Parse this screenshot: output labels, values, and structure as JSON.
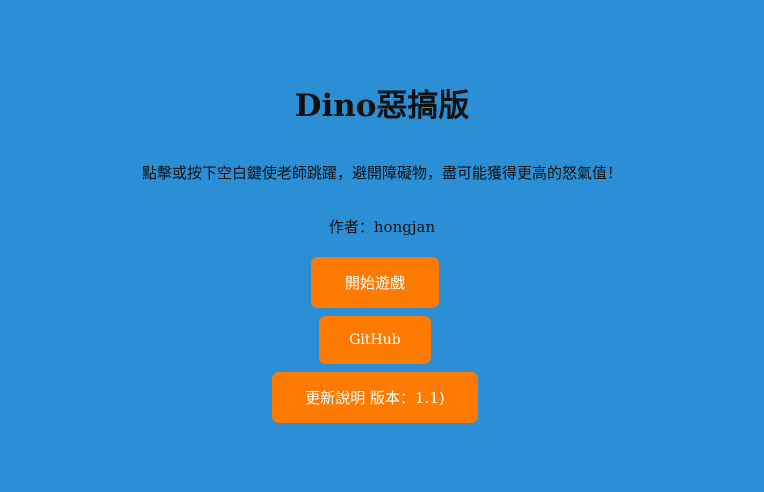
{
  "title": "Dino惡搞版",
  "description": "點擊或按下空白鍵使老師跳躍，避開障礙物，盡可能獲得更高的怒氣值！",
  "author_line": "作者：hongjan",
  "buttons": {
    "start_label": "開始遊戲",
    "github_label": "GitHub",
    "update_label": "更新說明 版本：1.1)"
  },
  "colors": {
    "background": "#2b8fd6",
    "button": "#ff7a00",
    "button_text": "#ffffff",
    "text": "#111111"
  }
}
